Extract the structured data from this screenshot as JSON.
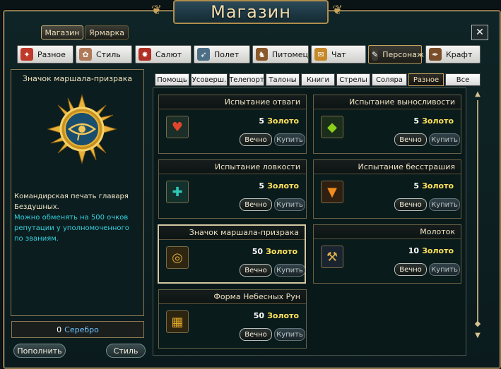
{
  "window": {
    "title": "Магазин",
    "close_label": "✕"
  },
  "top_tabs": [
    {
      "label": "Магазин"
    },
    {
      "label": "Ярмарка"
    }
  ],
  "categories": [
    {
      "label": "Разное",
      "color": "#c0392b",
      "glyph": "✦"
    },
    {
      "label": "Стиль",
      "color": "#b07a5a",
      "glyph": "✿"
    },
    {
      "label": "Салют",
      "color": "#b03025",
      "glyph": "✸"
    },
    {
      "label": "Полет",
      "color": "#4d6f86",
      "glyph": "➶"
    },
    {
      "label": "Питомец",
      "color": "#8a5a2b",
      "glyph": "♞"
    },
    {
      "label": "Чат",
      "color": "#c6892a",
      "glyph": "✉"
    },
    {
      "label": "Персонаж",
      "color": "#1a1a1a",
      "glyph": "✎"
    },
    {
      "label": "Крафт",
      "color": "#7b4e2a",
      "glyph": "✒"
    }
  ],
  "subtabs": [
    {
      "label": "Помощь"
    },
    {
      "label": "Усоверш."
    },
    {
      "label": "Телепорт"
    },
    {
      "label": "Талоны"
    },
    {
      "label": "Книги"
    },
    {
      "label": "Стрелы"
    },
    {
      "label": "Соляра"
    },
    {
      "label": "Разное"
    },
    {
      "label": "Все"
    }
  ],
  "detail": {
    "item_name": "Значок маршала-призрака",
    "description": "Командирская печать главаря Бездушных.",
    "exchange_note": "Можно обменять на 500 очков репутации у уполномоченного по званиям.",
    "balance": "0",
    "balance_currency": "Серебро"
  },
  "bottom_buttons": {
    "refill": "Пополнить",
    "style": "Стиль"
  },
  "products": [
    {
      "name": "Испытание отваги",
      "price": "5",
      "currency": "Золото",
      "perm_label": "Вечно",
      "buy_label": "Купить",
      "icon_color": "#e0452b",
      "icon_glyph": "♥"
    },
    {
      "name": "Испытание выносливости",
      "price": "5",
      "currency": "Золото",
      "perm_label": "Вечно",
      "buy_label": "Купить",
      "icon_color": "#8bd11b",
      "icon_glyph": "◆"
    },
    {
      "name": "Испытание ловкости",
      "price": "5",
      "currency": "Золото",
      "perm_label": "Вечно",
      "buy_label": "Купить",
      "icon_color": "#2fc7b6",
      "icon_glyph": "✚"
    },
    {
      "name": "Испытание бесстрашия",
      "price": "5",
      "currency": "Золото",
      "perm_label": "Вечно",
      "buy_label": "Купить",
      "icon_color": "#f28a1c",
      "icon_glyph": "▼"
    },
    {
      "name": "Значок маршала-призрака",
      "price": "50",
      "currency": "Золото",
      "perm_label": "Вечно",
      "buy_label": "Купить",
      "icon_color": "#d9a93a",
      "icon_glyph": "◎"
    },
    {
      "name": "Молоток",
      "price": "10",
      "currency": "Золото",
      "perm_label": "Вечно",
      "buy_label": "Купить",
      "icon_color": "#e0b44a",
      "icon_glyph": "⚒"
    },
    {
      "name": "Форма Небесных Рун",
      "price": "50",
      "currency": "Золото",
      "perm_label": "Вечно",
      "buy_label": "Купить",
      "icon_color": "#e3a92c",
      "icon_glyph": "▦"
    }
  ],
  "colors": {
    "gold": "#ffe35a",
    "cyan": "#35d0e0",
    "frame": "#8a7448"
  }
}
